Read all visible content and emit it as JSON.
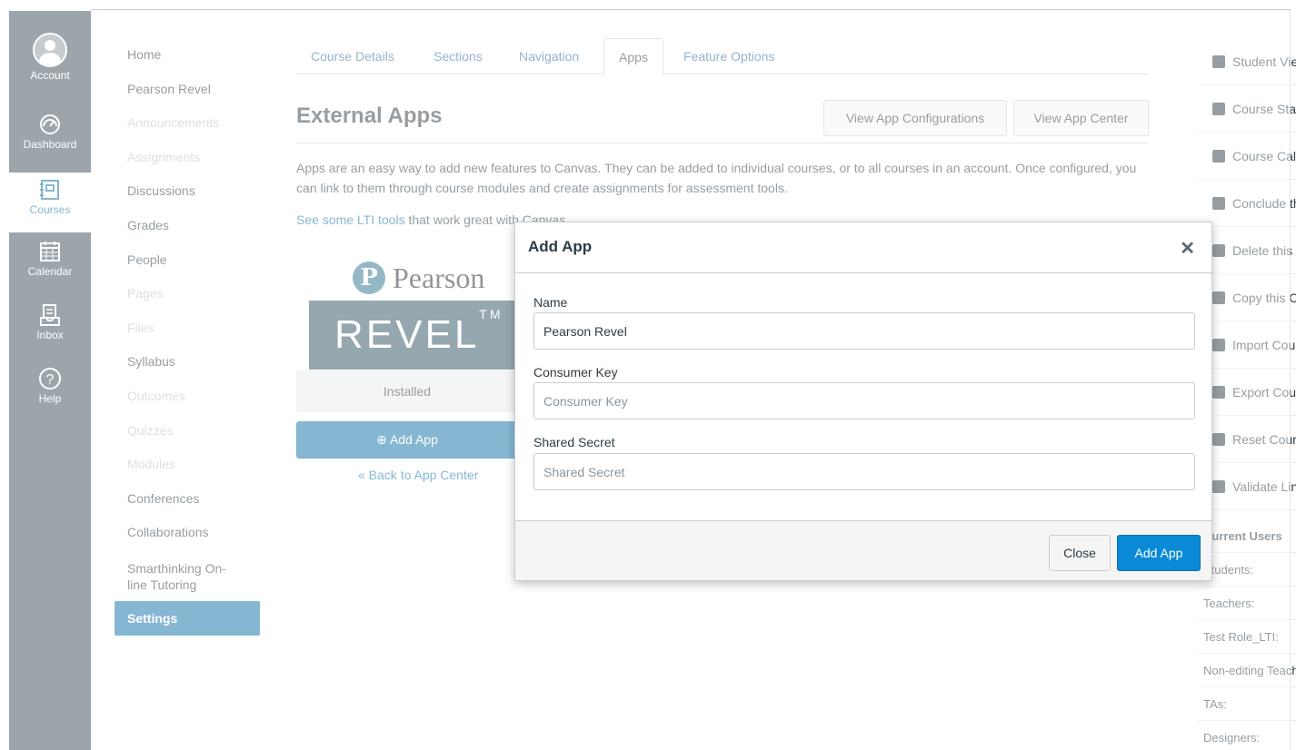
{
  "global_nav": {
    "items": [
      {
        "label": "Account",
        "icon": "account-avatar-icon"
      },
      {
        "label": "Dashboard",
        "icon": "dashboard-icon"
      },
      {
        "label": "Courses",
        "icon": "courses-icon"
      },
      {
        "label": "Calendar",
        "icon": "calendar-icon"
      },
      {
        "label": "Inbox",
        "icon": "inbox-icon"
      },
      {
        "label": "Help",
        "icon": "help-icon"
      }
    ]
  },
  "course_nav": {
    "items": [
      {
        "label": "Home"
      },
      {
        "label": "Pearson Revel"
      },
      {
        "label": "Announcements"
      },
      {
        "label": "Assignments"
      },
      {
        "label": "Discussions"
      },
      {
        "label": "Grades"
      },
      {
        "label": "People"
      },
      {
        "label": "Pages"
      },
      {
        "label": "Files"
      },
      {
        "label": "Syllabus"
      },
      {
        "label": "Outcomes"
      },
      {
        "label": "Quizzes"
      },
      {
        "label": "Modules"
      },
      {
        "label": "Conferences"
      },
      {
        "label": "Collaborations"
      },
      {
        "label": "Smarthinking On-line Tutoring"
      },
      {
        "label": "Settings"
      }
    ]
  },
  "tabs": [
    {
      "label": "Course Details"
    },
    {
      "label": "Sections"
    },
    {
      "label": "Navigation"
    },
    {
      "label": "Apps"
    },
    {
      "label": "Feature Options"
    }
  ],
  "main": {
    "title": "External Apps",
    "view_config_button": "View App Configurations",
    "view_center_button": "View App Center",
    "description": "Apps are an easy way to add new features to Canvas. They can be added to individual courses, or to all courses in an account. Once configured, you can link to them through course modules and create assignments for assessment tools.",
    "lti_link": "See some LTI tools",
    "lti_suffix": " that work great with Canvas."
  },
  "app_card": {
    "brand_letter": "P",
    "brand_word": "Pearson",
    "product": "REVEL",
    "trademark": "TM",
    "status": "Installed",
    "add_button": "⊕ Add App",
    "back_link": "« Back to App Center"
  },
  "right_sidebar": {
    "actions": [
      {
        "label": "Student View",
        "icon": "student-view-icon"
      },
      {
        "label": "Course Statistics",
        "icon": "statistics-icon"
      },
      {
        "label": "Course Calendar",
        "icon": "calendar-icon"
      },
      {
        "label": "Conclude this Course",
        "icon": "lock-icon"
      },
      {
        "label": "Delete this Course",
        "icon": "trash-icon"
      },
      {
        "label": "Copy this Course",
        "icon": "copy-icon"
      },
      {
        "label": "Import Course Content",
        "icon": "import-icon"
      },
      {
        "label": "Export Course Content",
        "icon": "export-icon"
      },
      {
        "label": "Reset Course Content",
        "icon": "reset-icon"
      },
      {
        "label": "Validate Links in Content",
        "icon": "link-icon"
      }
    ],
    "current_users_heading": "Current Users",
    "users": [
      {
        "label": "Students:"
      },
      {
        "label": "Teachers:"
      },
      {
        "label": "Test Role_LTI:"
      },
      {
        "label": "Non-editing Teachers:"
      },
      {
        "label": "TAs:"
      },
      {
        "label": "Designers:"
      }
    ]
  },
  "modal": {
    "title": "Add App",
    "name_label": "Name",
    "name_value": "Pearson Revel",
    "consumer_key_label": "Consumer Key",
    "consumer_key_placeholder": "Consumer Key",
    "shared_secret_label": "Shared Secret",
    "shared_secret_placeholder": "Shared Secret",
    "close_button": "Close",
    "add_button": "Add App"
  },
  "colors": {
    "nav_bg": "#394b58",
    "accent": "#0a6fa6",
    "primary_button": "#0a8ad6"
  }
}
